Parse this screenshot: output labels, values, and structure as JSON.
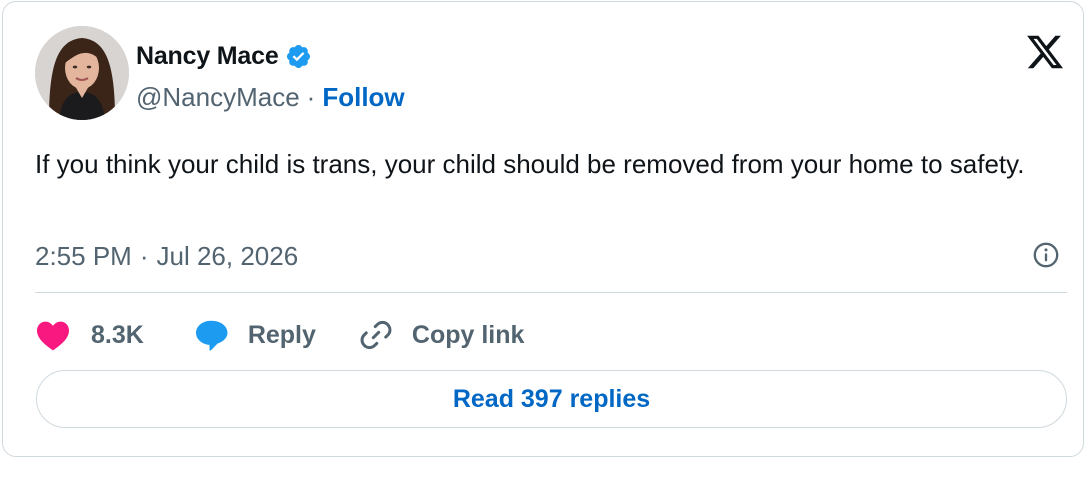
{
  "author": {
    "display_name": "Nancy Mace",
    "handle": "@NancyMace",
    "separator": "·",
    "follow_label": "Follow",
    "verified_icon": "verified-badge-icon",
    "verified_color": "#1d9bf0"
  },
  "platform": {
    "logo_icon": "x-logo-icon"
  },
  "tweet": {
    "text": "If you think your child is trans, your child should be removed from your home to safety.",
    "time": "2:55 PM",
    "separator": "·",
    "date": "Jul 26, 2026",
    "info_icon": "info-icon"
  },
  "actions": {
    "like_icon": "heart-icon",
    "like_count": "8.3K",
    "like_color": "#f91880",
    "reply_icon": "speech-bubble-icon",
    "reply_label": "Reply",
    "reply_color": "#1d9bf0",
    "copy_icon": "link-icon",
    "copy_label": "Copy link"
  },
  "footer": {
    "read_replies_label": "Read 397 replies"
  },
  "colors": {
    "link_blue": "#0067c5",
    "secondary_text": "#536471",
    "border": "#cfd9de"
  }
}
